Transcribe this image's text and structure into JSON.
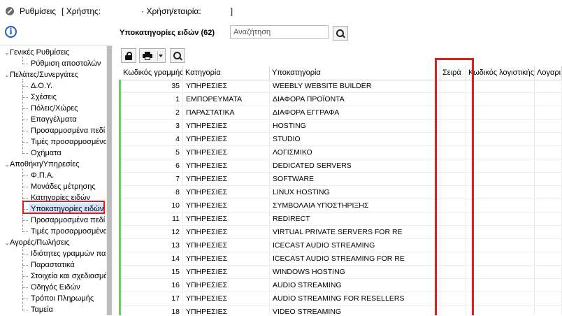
{
  "window": {
    "title": "Ρυθμίσεις",
    "user_part": "[ Χρήστης:",
    "company_part": "· Χρήση/εταιρία:",
    "close_bracket": "]"
  },
  "tree": {
    "groups": [
      {
        "label": "Γενικές Ρυθμίσεις",
        "children": [
          "Ρύθμιση αποστολών"
        ]
      },
      {
        "label": "Πελάτες/Συνεργάτες",
        "children": [
          "Δ.Ο.Υ.",
          "Σχέσεις",
          "Πόλεις/Χώρες",
          "Επαγγέλματα",
          "Προσαρμοσμένα πεδί",
          "Τιμές προσαρμοσμένα",
          "Οχήματα"
        ]
      },
      {
        "label": "Αποθήκη/Υπηρεσίες",
        "children": [
          "Φ.Π.Α.",
          "Μονάδες μέτρησης",
          "Κατηγορίες ειδών",
          "Υποκατηγορίες ειδών",
          "Προσαρμοσμένα πεδί",
          "Τιμές προσαρμοσμένα"
        ]
      },
      {
        "label": "Αγορές/Πωλήσεις",
        "children": [
          "Ιδιότητες γραμμών πα",
          "Παραστατικά",
          "Στοιχεία και σχεδιασμό",
          "Οδηγός Ειδών",
          "Τρόποι Πληρωμής",
          "Ταμεία"
        ]
      }
    ],
    "selected": "Υποκατηγορίες ειδών"
  },
  "header": {
    "title": "Υποκατηγορίες ειδών (62)",
    "search_placeholder": "Αναζήτηση"
  },
  "grid": {
    "columns": [
      "Κωδικός γραμμής",
      "Κατηγορία",
      "Υποκατηγορία",
      "Σειρά",
      "Κωδικός λογιστικής",
      "Λογαρι"
    ],
    "rows": [
      [
        "35",
        "ΥΠΗΡΕΣΙΕΣ",
        "WEEBLY WEBSITE BUILDER"
      ],
      [
        "1",
        "ΕΜΠΟΡΕΥΜΑΤΑ",
        "ΔΙΑΦΟΡΑ ΠΡΟΪΟΝΤΑ"
      ],
      [
        "2",
        "ΠΑΡΑΣΤΑΤΙΚΑ",
        "ΔΙΑΦΟΡΑ ΕΓΓΡΑΦΑ"
      ],
      [
        "3",
        "ΥΠΗΡΕΣΙΕΣ",
        "HOSTING"
      ],
      [
        "4",
        "ΥΠΗΡΕΣΙΕΣ",
        "STUDIO"
      ],
      [
        "5",
        "ΥΠΗΡΕΣΙΕΣ",
        "ΛΟΓΙΣΜΙΚΟ"
      ],
      [
        "6",
        "ΥΠΗΡΕΣΙΕΣ",
        "DEDICATED SERVERS"
      ],
      [
        "7",
        "ΥΠΗΡΕΣΙΕΣ",
        "SOFTWARE"
      ],
      [
        "8",
        "ΥΠΗΡΕΣΙΕΣ",
        "LINUX HOSTING"
      ],
      [
        "10",
        "ΥΠΗΡΕΣΙΕΣ",
        "ΣΥΜΒΟΛΑΙΑ ΥΠΟΣΤΗΡΙΞΗΣ"
      ],
      [
        "11",
        "ΥΠΗΡΕΣΙΕΣ",
        "REDIRECT"
      ],
      [
        "12",
        "ΥΠΗΡΕΣΙΕΣ",
        "VIRTUAL PRIVATE SERVERS FOR RE"
      ],
      [
        "13",
        "ΥΠΗΡΕΣΙΕΣ",
        "ICECAST AUDIO STREAMING"
      ],
      [
        "14",
        "ΥΠΗΡΕΣΙΕΣ",
        "ICECAST AUDIO STREAMING FOR RE"
      ],
      [
        "15",
        "ΥΠΗΡΕΣΙΕΣ",
        "WINDOWS HOSTING"
      ],
      [
        "16",
        "ΥΠΗΡΕΣΙΕΣ",
        "AUDIO STREAMING"
      ],
      [
        "17",
        "ΥΠΗΡΕΣΙΕΣ",
        "AUDIO STREAMING FOR RESELLERS"
      ],
      [
        "18",
        "ΥΠΗΡΕΣΙΕΣ",
        "VIDEO STREAMING"
      ]
    ]
  },
  "colors": {
    "highlight_red": "#e31b1b",
    "selection_blue": "#cfe3fa",
    "row_marker_green": "#5fd35f",
    "info_blue": "#1f5fbf"
  }
}
